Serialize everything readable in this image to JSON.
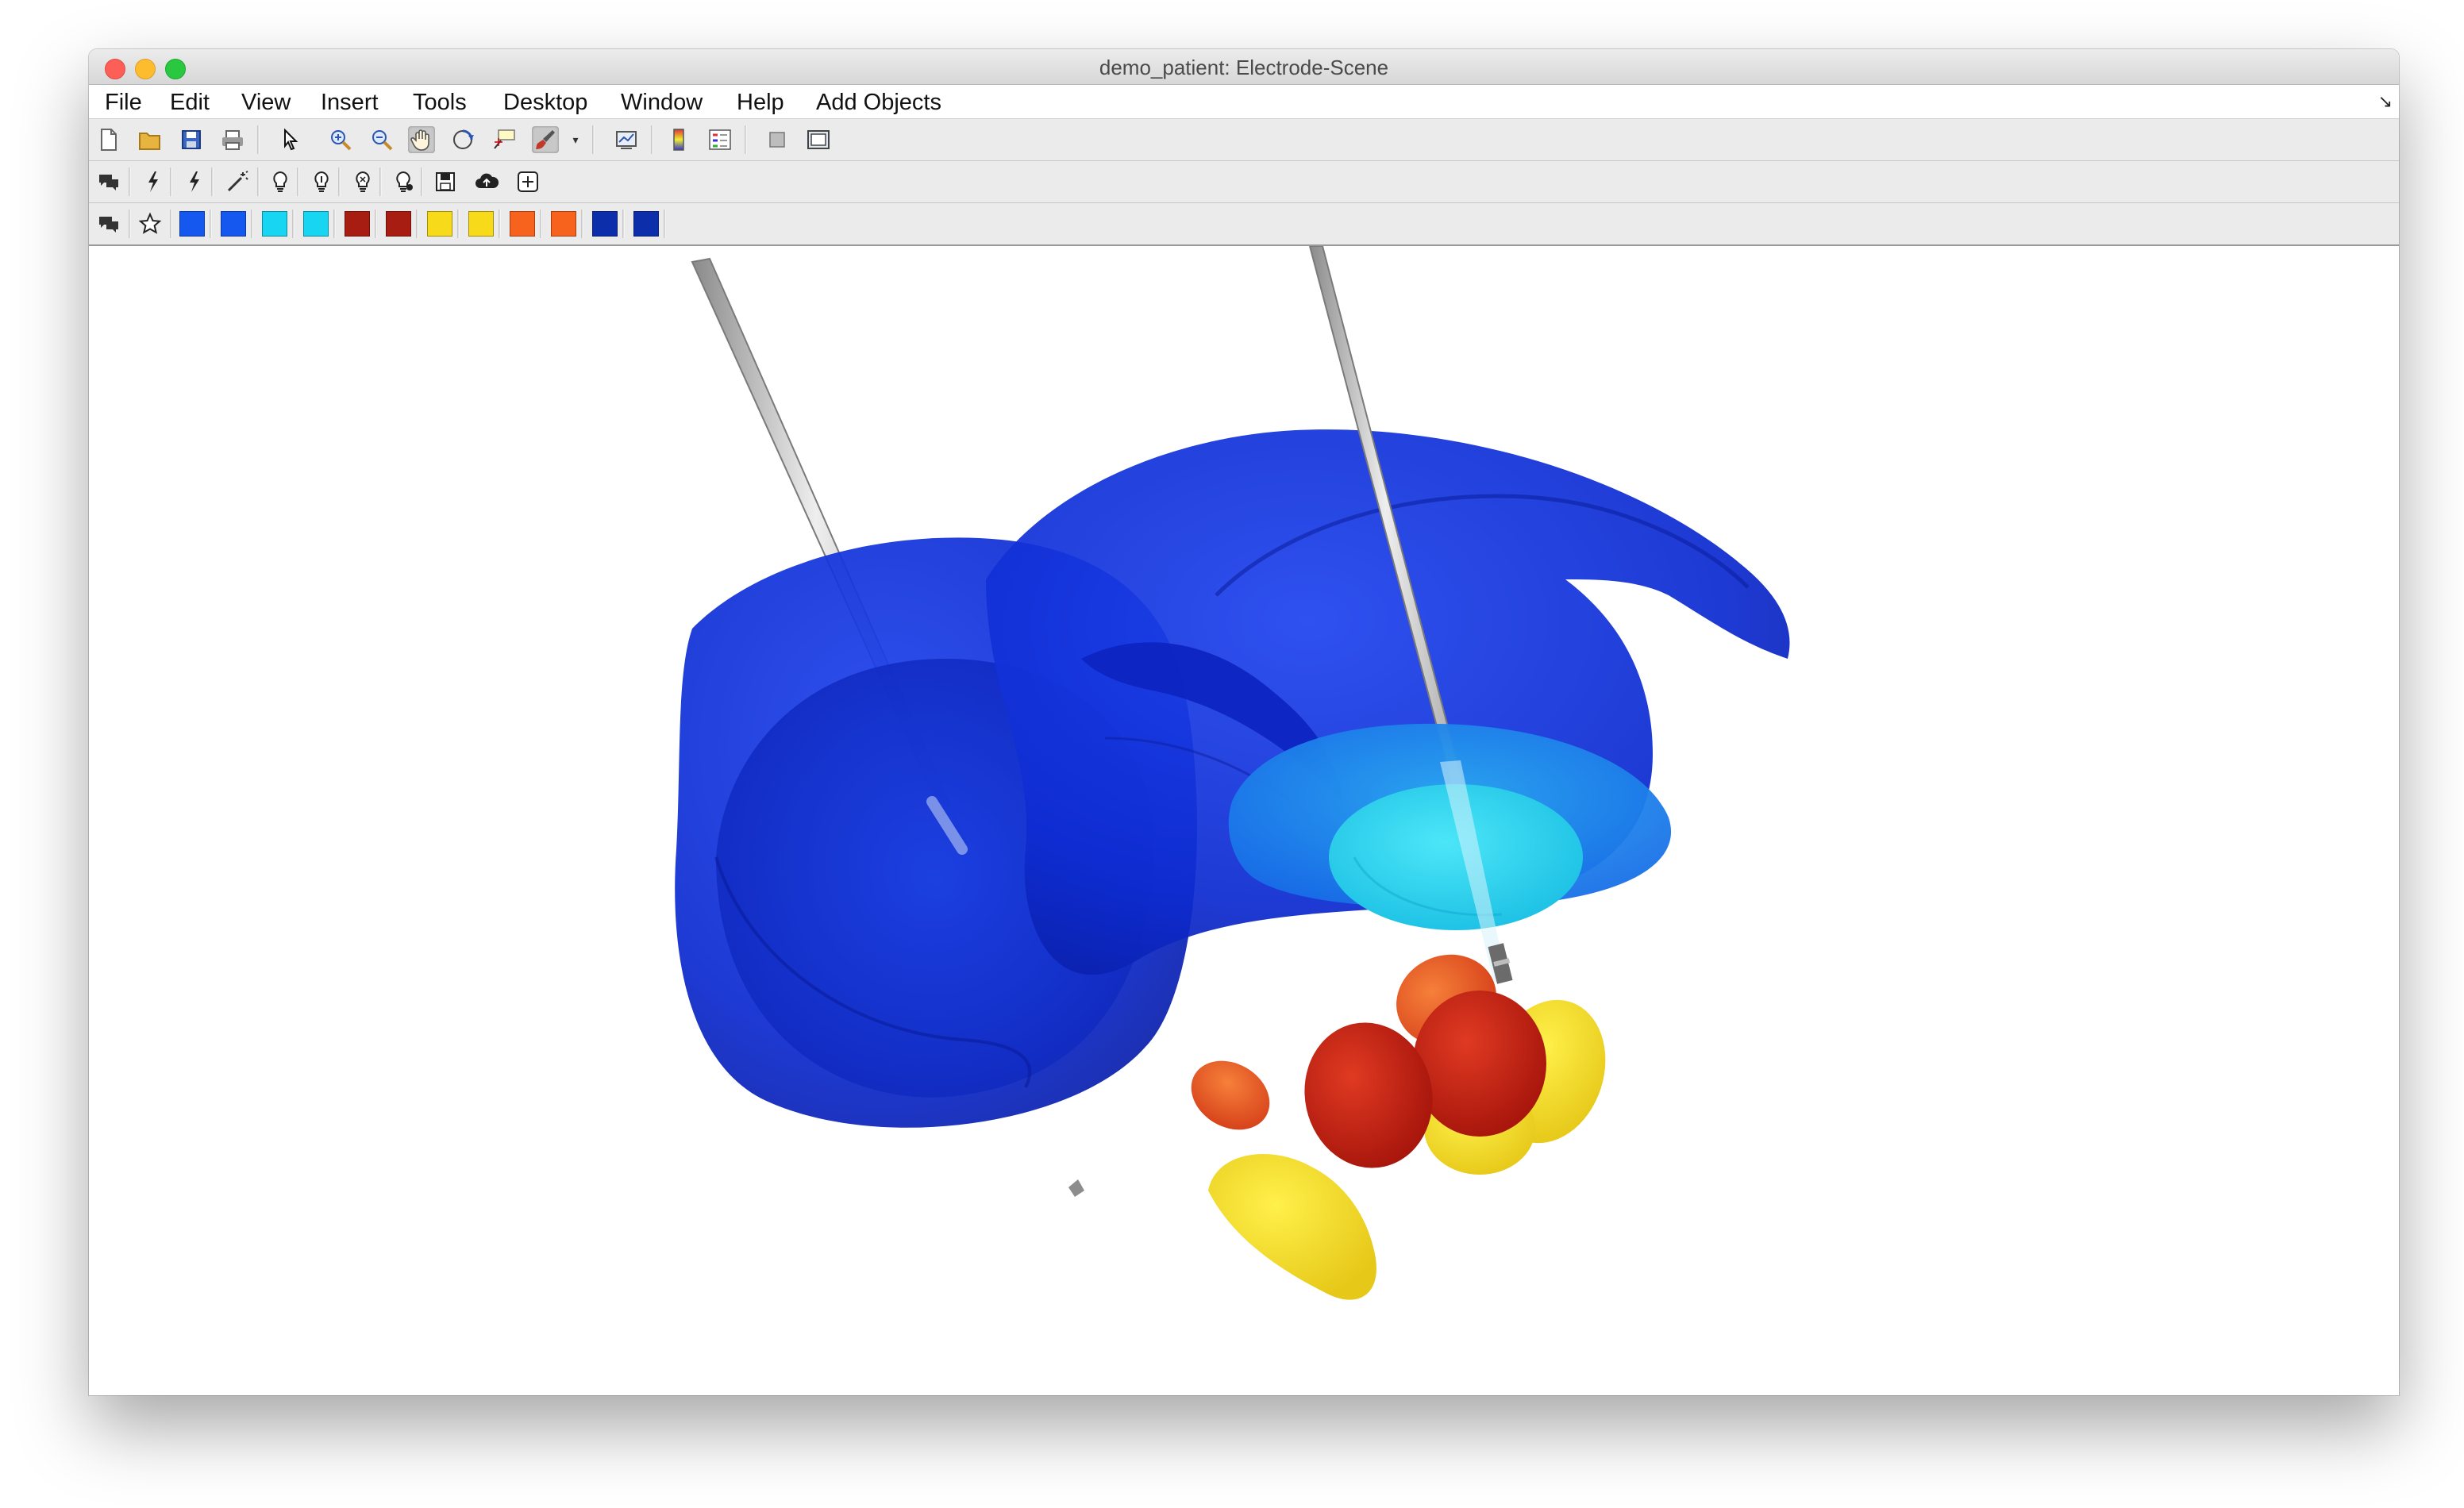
{
  "window": {
    "title": "demo_patient: Electrode-Scene"
  },
  "menubar": {
    "items": [
      {
        "label": "File"
      },
      {
        "label": "Edit"
      },
      {
        "label": "View"
      },
      {
        "label": "Insert"
      },
      {
        "label": "Tools"
      },
      {
        "label": "Desktop"
      },
      {
        "label": "Window"
      },
      {
        "label": "Help"
      },
      {
        "label": "Add Objects"
      }
    ]
  },
  "toolbar_main": {
    "icons": [
      "new-figure-icon",
      "open-file-icon",
      "save-icon",
      "print-icon",
      "pointer-icon",
      "zoom-in-icon",
      "zoom-out-icon",
      "pan-hand-icon",
      "rotate-3d-icon",
      "data-cursor-icon",
      "brush-icon",
      "brush-dropdown-icon",
      "link-plot-icon",
      "colorbar-icon",
      "legend-icon",
      "hide-plot-tools-icon",
      "show-plot-tools-icon"
    ]
  },
  "toolbar_electrodes": {
    "icons": [
      "comments-icon",
      "electrode-1-icon",
      "electrode-2-icon",
      "magic-wand-icon",
      "lightbulb-icon",
      "lightbulb-2-icon",
      "lightbulb-3-icon",
      "lightbulb-4-icon",
      "save-scene-icon",
      "cloud-upload-icon",
      "add-object-icon"
    ]
  },
  "toolbar_atlas": {
    "icons": [
      "comments-icon",
      "star-icon"
    ],
    "swatches": [
      "#1558f0",
      "#1558f0",
      "#18d6f2",
      "#18d6f2",
      "#a81d11",
      "#a81d11",
      "#f7db1a",
      "#f7db1a",
      "#f7621c",
      "#f7621c",
      "#0d2eaa",
      "#0d2eaa"
    ]
  },
  "scene": {
    "colors": {
      "blue_structure": "#0d2bd0",
      "cyan_structure": "#20d0ee",
      "red_structure": "#c41a10",
      "yellow_structure": "#f0dc1c",
      "orange_structure": "#ee5a1a",
      "electrode": "#b8b8b8"
    }
  }
}
